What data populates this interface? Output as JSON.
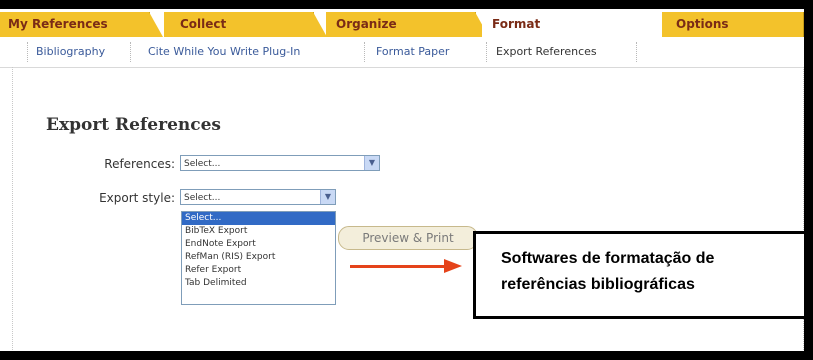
{
  "tabs": [
    "My References",
    "Collect",
    "Organize",
    "Format",
    "Options"
  ],
  "subnav": [
    "Bibliography",
    "Cite While You Write Plug-In",
    "Format Paper",
    "Export References"
  ],
  "page_title": "Export References",
  "form": {
    "references_label": "References:",
    "references_value": "Select...",
    "export_style_label": "Export style:",
    "export_style_value": "Select...",
    "export_options": [
      "Select...",
      "BibTeX Export",
      "EndNote Export",
      "RefMan (RIS) Export",
      "Refer Export",
      "Tab Delimited"
    ]
  },
  "preview_button": "Preview & Print",
  "callout": {
    "line1": "Softwares de formatação de",
    "line2": "referências bibliográficas"
  },
  "colors": {
    "tab_bg": "#f3c22b",
    "tab_text": "#7a2b16",
    "link": "#3a5a9a",
    "arrow": "#e5431a",
    "selection": "#316ac5"
  }
}
